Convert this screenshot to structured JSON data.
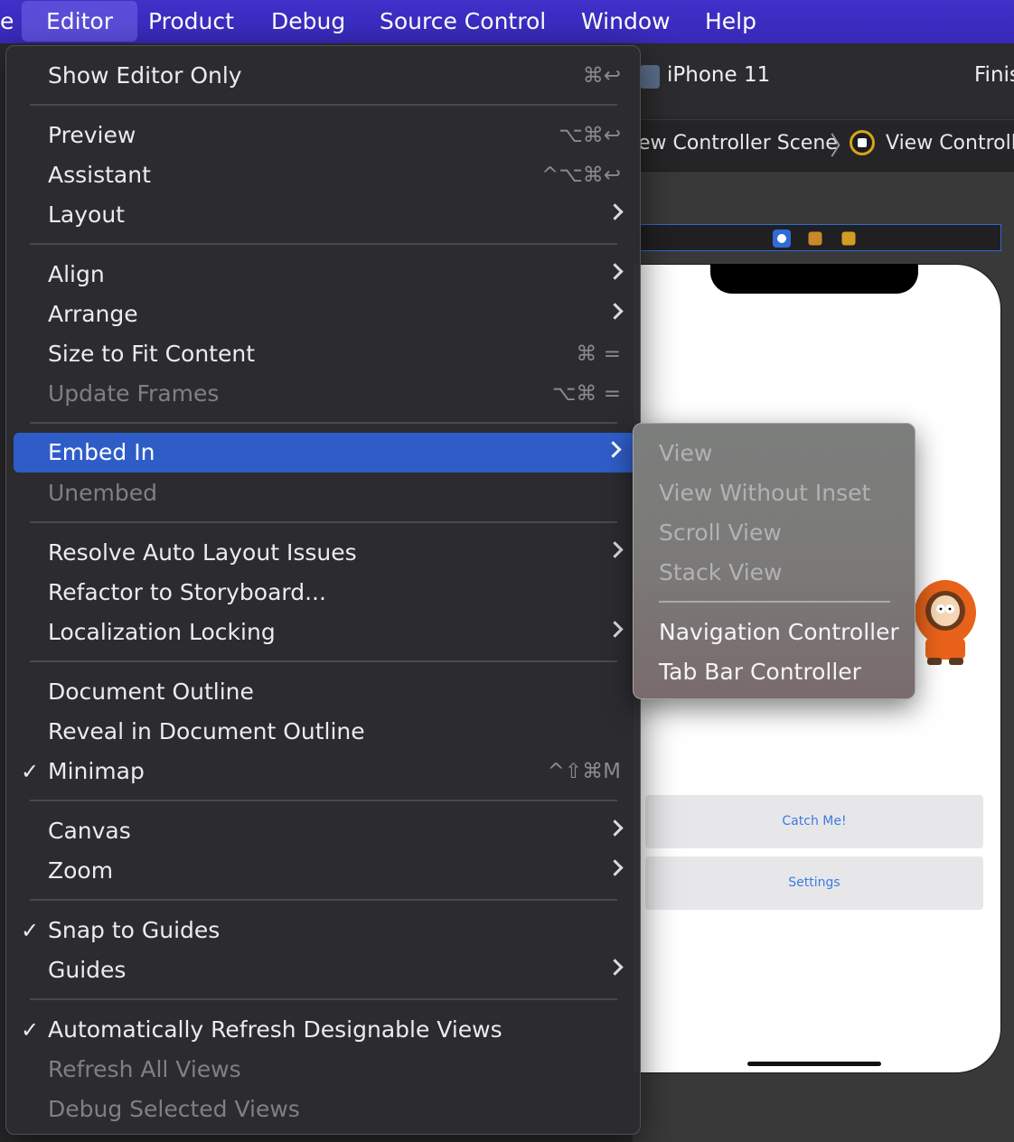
{
  "menubar": {
    "items": [
      "e",
      "Editor",
      "Product",
      "Debug",
      "Source Control",
      "Window",
      "Help"
    ],
    "active": "Editor"
  },
  "xcode": {
    "device": "iPhone 11",
    "status": "Finis",
    "breadcrumb": {
      "scene": "ew Controller Scene",
      "separator": "〉",
      "controller": "View Controlle"
    },
    "buttons": {
      "catch": "Catch Me!",
      "settings": "Settings"
    }
  },
  "editor_menu": {
    "show_editor_only": {
      "label": "Show Editor Only",
      "shortcut": "⌘↩"
    },
    "preview": {
      "label": "Preview",
      "shortcut": "⌥⌘↩"
    },
    "assistant": {
      "label": "Assistant",
      "shortcut": "^⌥⌘↩"
    },
    "layout": {
      "label": "Layout"
    },
    "align": {
      "label": "Align"
    },
    "arrange": {
      "label": "Arrange"
    },
    "size_to_fit": {
      "label": "Size to Fit Content",
      "shortcut": "⌘ ="
    },
    "update_frames": {
      "label": "Update Frames",
      "shortcut": "⌥⌘ ="
    },
    "embed_in": {
      "label": "Embed In"
    },
    "unembed": {
      "label": "Unembed"
    },
    "resolve_auto_layout": {
      "label": "Resolve Auto Layout Issues"
    },
    "refactor_storyboard": {
      "label": "Refactor to Storyboard..."
    },
    "localization_locking": {
      "label": "Localization Locking"
    },
    "document_outline": {
      "label": "Document Outline"
    },
    "reveal_outline": {
      "label": "Reveal in Document Outline"
    },
    "minimap": {
      "label": "Minimap",
      "shortcut": "^⇧⌘M",
      "check": "✓"
    },
    "canvas": {
      "label": "Canvas"
    },
    "zoom": {
      "label": "Zoom"
    },
    "snap_to_guides": {
      "label": "Snap to Guides",
      "check": "✓"
    },
    "guides": {
      "label": "Guides"
    },
    "auto_refresh": {
      "label": "Automatically Refresh Designable Views",
      "check": "✓"
    },
    "refresh_all": {
      "label": "Refresh All Views"
    },
    "debug_selected": {
      "label": "Debug Selected Views"
    }
  },
  "embed_submenu": {
    "view": "View",
    "view_without_inset": "View Without Inset",
    "scroll_view": "Scroll View",
    "stack_view": "Stack View",
    "navigation_controller": "Navigation Controller",
    "tab_bar_controller": "Tab Bar Controller"
  },
  "colors": {
    "menubar": "#3a2cbf",
    "selection": "#2f5dc8",
    "menu_bg": "#2c2c30"
  }
}
